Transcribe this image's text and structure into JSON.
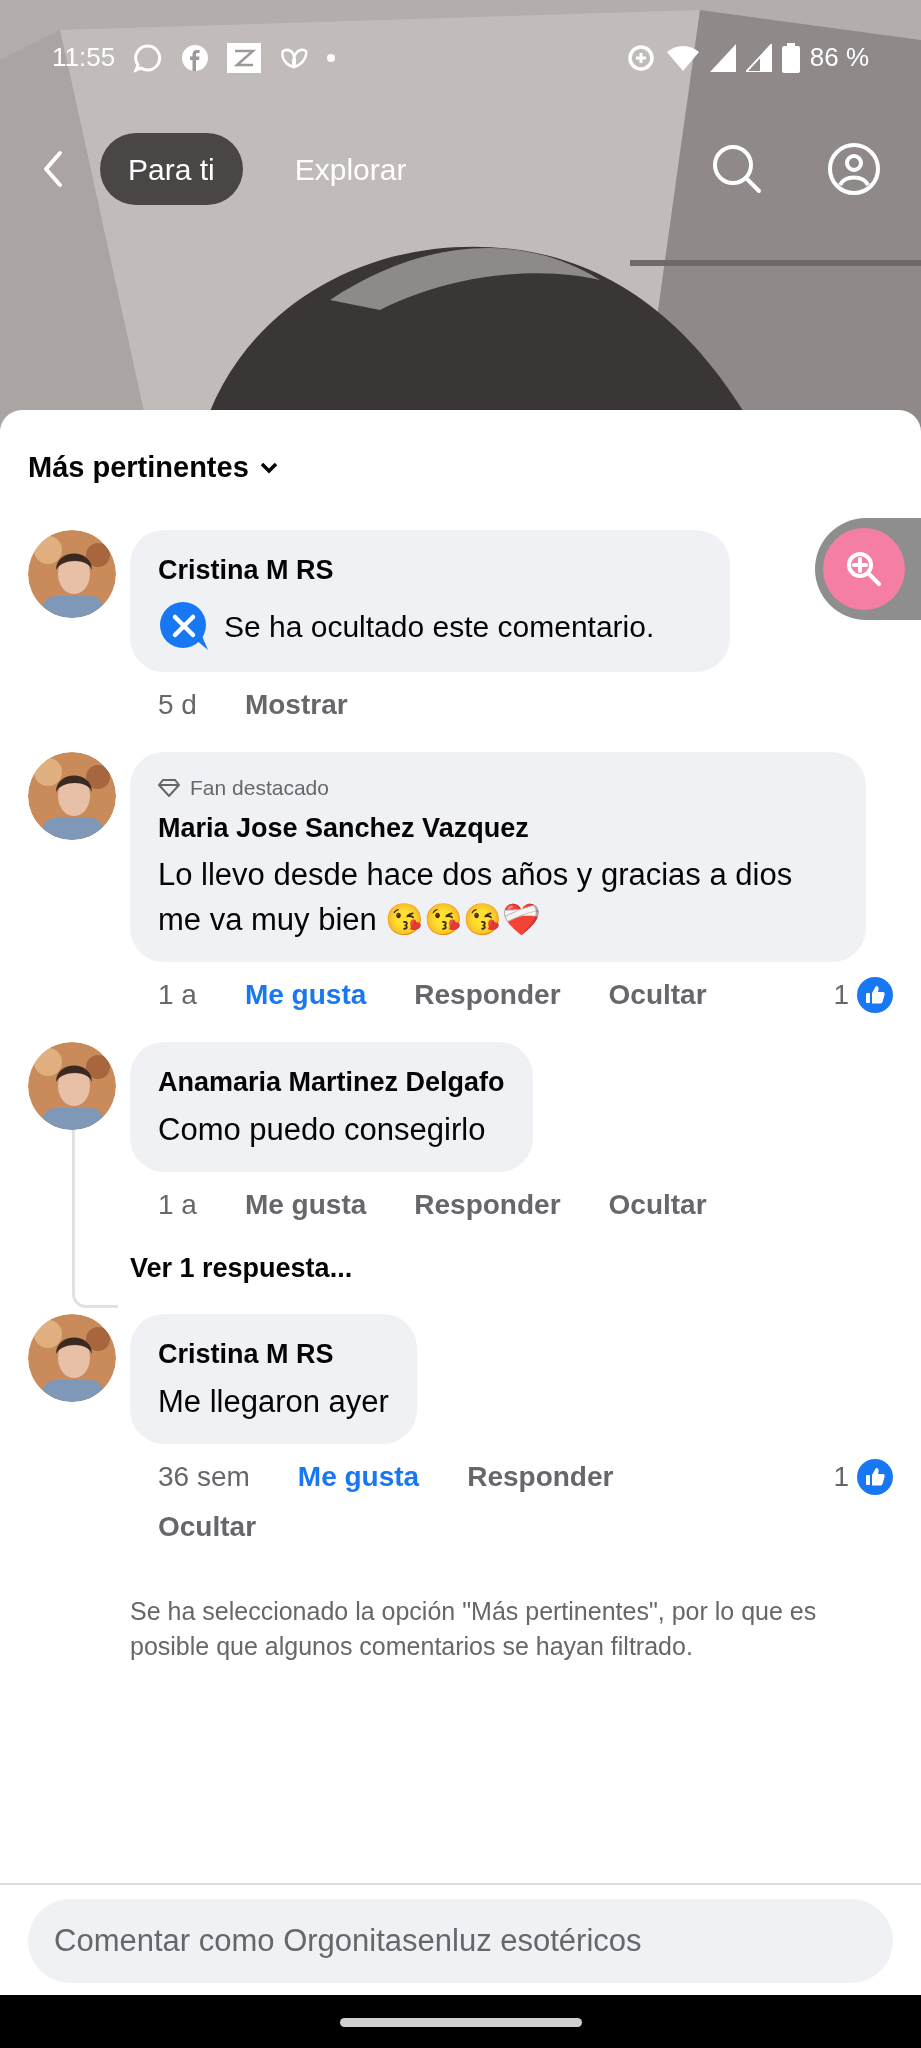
{
  "status_bar": {
    "time": "11:55",
    "battery": "86 %"
  },
  "header": {
    "tabs": [
      {
        "label": "Para ti",
        "selected": true
      },
      {
        "label": "Explorar",
        "selected": false
      }
    ]
  },
  "sort": {
    "label": "Más pertinentes"
  },
  "comments": [
    {
      "kind": "hidden",
      "author": "Cristina M RS",
      "text": "Se ha ocultado este comentario.",
      "time": "5 d",
      "actions": [
        {
          "label": "Mostrar",
          "kind": "bold"
        }
      ]
    },
    {
      "kind": "normal",
      "badge": "Fan destacado",
      "author": "Maria Jose Sanchez Vazquez",
      "text": "Lo llevo desde hace dos años y gracias a dios me va muy bien 😘😘😘❤️‍🩹",
      "time": "1 a",
      "actions": [
        {
          "label": "Me gusta",
          "kind": "like",
          "liked": true
        },
        {
          "label": "Responder",
          "kind": "plain"
        },
        {
          "label": "Ocultar",
          "kind": "bold"
        }
      ],
      "reactions": "1"
    },
    {
      "kind": "normal",
      "author": "Anamaria Martinez Delgafo",
      "text": "Como puedo consegirlo",
      "time": "1 a",
      "actions": [
        {
          "label": "Me gusta",
          "kind": "like",
          "liked": false
        },
        {
          "label": "Responder",
          "kind": "plain"
        },
        {
          "label": "Ocultar",
          "kind": "bold"
        }
      ],
      "replies": "Ver 1 respuesta..."
    },
    {
      "kind": "normal",
      "author": "Cristina M RS",
      "text": "Me llegaron ayer",
      "time": "36 sem",
      "actions": [
        {
          "label": "Me gusta",
          "kind": "like",
          "liked": true
        },
        {
          "label": "Responder",
          "kind": "plain"
        },
        {
          "label": "Ocultar",
          "kind": "bold"
        }
      ],
      "reactions": "1"
    }
  ],
  "note": "Se ha seleccionado la opción \"Más pertinentes\", por lo que es posible que algunos comentarios se hayan filtrado.",
  "composer": {
    "placeholder": "Comentar como Orgonitasenluz esotéricos"
  }
}
